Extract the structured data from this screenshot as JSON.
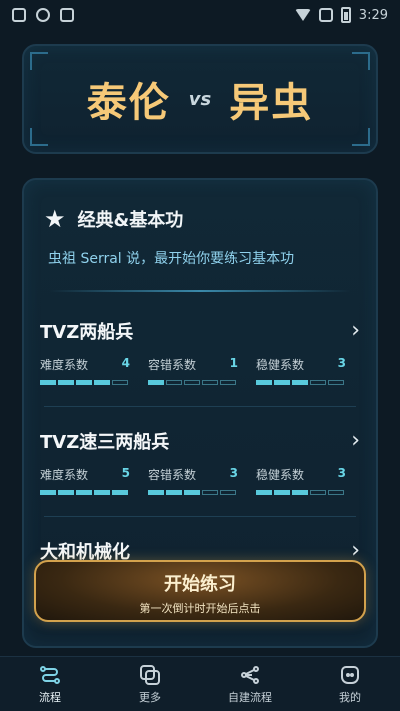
{
  "status": {
    "time": "3:29"
  },
  "header": {
    "left_race": "泰伦",
    "vs": "vs",
    "right_race": "异虫"
  },
  "section": {
    "title": "经典&基本功",
    "subtitle": "虫祖 Serral 说，最开始你要练习基本功",
    "icon": "star-icon"
  },
  "drills": [
    {
      "title": "TVZ两船兵",
      "metrics": [
        {
          "label": "难度系数",
          "value": "4",
          "level": 4,
          "max": 5
        },
        {
          "label": "容错系数",
          "value": "1",
          "level": 1,
          "max": 5
        },
        {
          "label": "稳健系数",
          "value": "3",
          "level": 3,
          "max": 5
        }
      ]
    },
    {
      "title": "TVZ速三两船兵",
      "metrics": [
        {
          "label": "难度系数",
          "value": "5",
          "level": 5,
          "max": 5
        },
        {
          "label": "容错系数",
          "value": "3",
          "level": 3,
          "max": 5
        },
        {
          "label": "稳健系数",
          "value": "3",
          "level": 3,
          "max": 5
        }
      ]
    },
    {
      "title": "大和机械化"
    }
  ],
  "cta": {
    "label": "开始练习",
    "sublabel": "第一次倒计时开始后点击"
  },
  "tabs": [
    {
      "label": "流程",
      "icon": "flow-icon",
      "active": true
    },
    {
      "label": "更多",
      "icon": "copy-icon",
      "active": false
    },
    {
      "label": "自建流程",
      "icon": "share-icon",
      "active": false
    },
    {
      "label": "我的",
      "icon": "face-icon",
      "active": false
    }
  ],
  "colors": {
    "accent": "#58c9dc",
    "gold": "#f6c978",
    "cta_border": "#d3a24d",
    "background": "#0d1a24"
  }
}
